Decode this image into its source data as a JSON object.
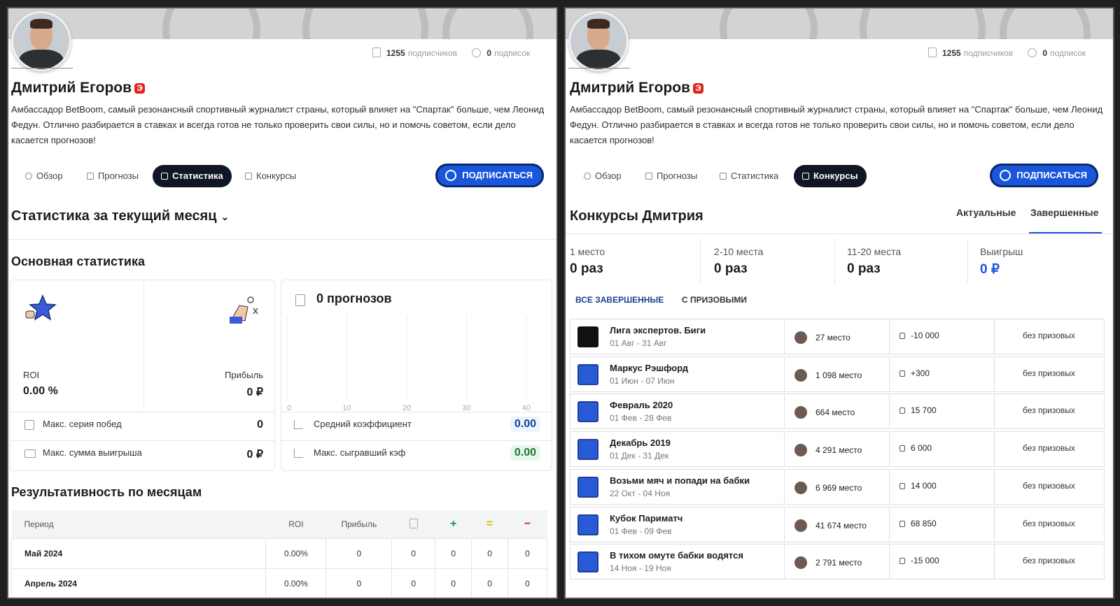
{
  "profile": {
    "name": "Дмитрий Егоров",
    "badge": "Э",
    "subscribers": "1255",
    "subscribers_label": "подписчиков",
    "subscriptions": "0",
    "subscriptions_label": "подписок",
    "bio": "Амбассадор BetBoom, самый резонансный спортивный журналист страны, который влияет на \"Спартак\" больше, чем Леонид Федун. Отлично разбирается в ставках и всегда готов не только проверить свои силы, но и помочь советом, если дело касается прогнозов!"
  },
  "tabs": [
    "Обзор",
    "Прогнозы",
    "Статистика",
    "Конкурсы"
  ],
  "subscribe_label": "ПОДПИСАТЬСЯ",
  "left": {
    "title": "Статистика за текущий месяц",
    "main_stats_title": "Основная статистика",
    "roi_label": "ROI",
    "roi_value": "0.00 %",
    "profit_label": "Прибыль",
    "profit_value": "0 ₽",
    "forecasts_title": "0 прогнозов",
    "axis_ticks": [
      "0",
      "10",
      "20",
      "30",
      "40"
    ],
    "max_win_streak_label": "Макс. серия побед",
    "max_win_streak_value": "0",
    "max_win_sum_label": "Макс. сумма выигрыша",
    "max_win_sum_value": "0 ₽",
    "avg_coef_label": "Средний коэффициент",
    "avg_coef_value": "0.00",
    "max_coef_label": "Макс. сыгравший кэф",
    "max_coef_value": "0.00",
    "monthly_title": "Результативность по месяцам",
    "monthly_headers": [
      "Период",
      "ROI",
      "Прибыль",
      "",
      "+",
      "=",
      "−"
    ],
    "monthly_rows": [
      [
        "Май 2024",
        "0.00%",
        "0",
        "0",
        "0",
        "0",
        "0"
      ],
      [
        "Апрель 2024",
        "0.00%",
        "0",
        "0",
        "0",
        "0",
        "0"
      ]
    ]
  },
  "right": {
    "title": "Конкурсы Дмитрия",
    "tab_actual": "Актуальные",
    "tab_finished": "Завершенные",
    "stats": [
      {
        "label": "1 место",
        "value": "0 раз"
      },
      {
        "label": "2-10 места",
        "value": "0 раз"
      },
      {
        "label": "11-20 места",
        "value": "0 раз"
      },
      {
        "label": "Выигрыш",
        "value": "0 ₽"
      }
    ],
    "filter_all": "ВСЕ ЗАВЕРШЕННЫЕ",
    "filter_prize": "С ПРИЗОВЫМИ",
    "contests": [
      {
        "name": "Лига экспертов. Биги",
        "dates": "01 Авг - 31 Авг",
        "place": "27 место",
        "amount": "-10 000",
        "prize": "без призовых"
      },
      {
        "name": "Маркус Рэшфорд",
        "dates": "01 Июн - 07 Июн",
        "place": "1 098 место",
        "amount": "+300",
        "prize": "без призовых"
      },
      {
        "name": "Февраль 2020",
        "dates": "01 Фев - 28 Фев",
        "place": "664 место",
        "amount": "15 700",
        "prize": "без призовых"
      },
      {
        "name": "Декабрь 2019",
        "dates": "01 Дек - 31 Дек",
        "place": "4 291 место",
        "amount": "6 000",
        "prize": "без призовых"
      },
      {
        "name": "Возьми мяч и попади на бабки",
        "dates": "22 Окт - 04 Ноя",
        "place": "6 969 место",
        "amount": "14 000",
        "prize": "без призовых"
      },
      {
        "name": "Кубок Париматч",
        "dates": "01 Фев - 09 Фев",
        "place": "41 674 место",
        "amount": "68 850",
        "prize": "без призовых"
      },
      {
        "name": "В тихом омуте бабки водятся",
        "dates": "14 Ноя - 19 Ноя",
        "place": "2 791 место",
        "amount": "-15 000",
        "prize": "без призовых"
      }
    ]
  },
  "colors": {
    "accent": "#1a56db",
    "dark": "#0f1724",
    "plus": "#1a9c3c",
    "equal": "#e3b700",
    "minus": "#d81e1e"
  }
}
